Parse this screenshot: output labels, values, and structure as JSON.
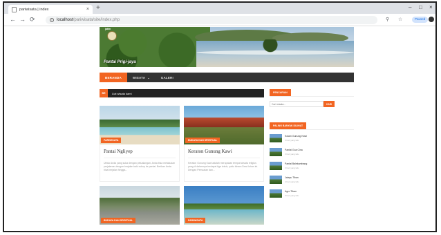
{
  "browser": {
    "tab_title": "pariwisata | index",
    "new_tab": "+",
    "url_host": "localhost",
    "url_path": "/pariwisata/site/index.php",
    "profile_label": "Paused",
    "window_controls": [
      "–",
      "□",
      "×"
    ]
  },
  "header": {
    "logo_text": "jatim",
    "site_title": "Pantai Prigi-jaya"
  },
  "nav": {
    "items": [
      {
        "label": "BERANDA",
        "active": true
      },
      {
        "label": "WISATA",
        "caret": "⌄"
      },
      {
        "label": "GALERI"
      }
    ]
  },
  "ticker": {
    "label": "BR",
    "text": "Liat wisata kami"
  },
  "cards": [
    {
      "category": "PARIWISATA",
      "title": "Pantai Ngliyep",
      "excerpt": "Untuk Anda yang suka dengan petualangan, Anda bisa melakukan perjalanan dengan berjalan kaki cukup ke pantai. Berikan Anda bisa berjalan hingga...",
      "image": "beach"
    },
    {
      "category": "BUDAYA DAN SPIRITUAL",
      "title": "Keraton Gunung Kawi",
      "excerpt": "Keraton Gunung Kawi adalah merupakan tempat wisata religius yang di dalamnya terdapat tiga tokoh, yaitu Ishara Dewi Ishan ini. Dengan Pemuaian dan...",
      "image": "temple"
    },
    {
      "category": "BUDAYA DAN SPIRITUAL",
      "title": "",
      "excerpt": "",
      "image": "temple2"
    },
    {
      "category": "PARIWISATA",
      "title": "",
      "excerpt": "",
      "image": "beach2"
    }
  ],
  "sidebar": {
    "search_head": "PENCARIAN",
    "search_placeholder": "Cari wisata...",
    "search_button": "CARI",
    "popular_head": "PALING BANYAK DILIHAT",
    "popular": [
      {
        "title": "Kolam Gunung Kawi",
        "date": "3 hari yang lalu"
      },
      {
        "title": "Pantai Goa Cina",
        "date": "3 hari yang lalu"
      },
      {
        "title": "Pantai Balekambang",
        "date": "3 hari yang lalu"
      },
      {
        "title": "Jatayu Tiban",
        "date": "4 hari yang lalu"
      },
      {
        "title": "Agro Tiban",
        "date": "5 hari yang lalu"
      }
    ]
  }
}
